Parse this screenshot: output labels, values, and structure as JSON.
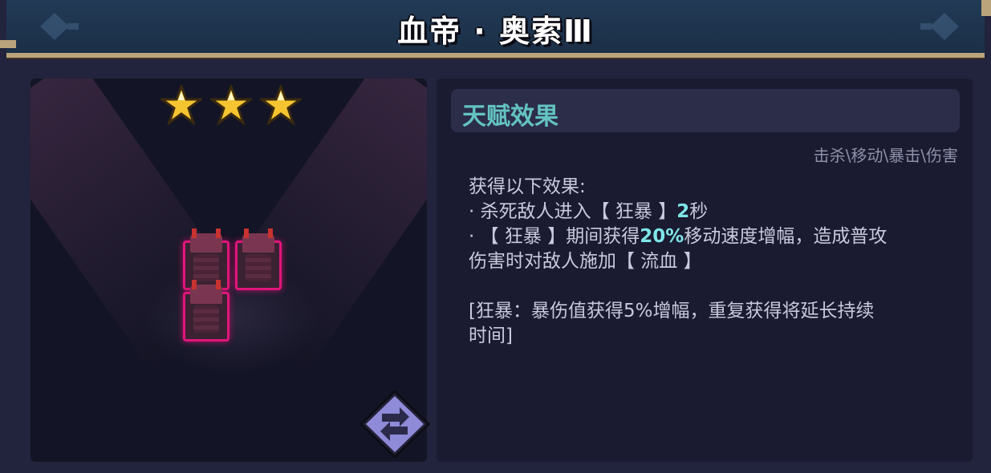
{
  "title": "血帝 · 奥索Ⅲ",
  "stars": {
    "count": 3,
    "max": 3,
    "color": "#f5c531"
  },
  "colors": {
    "accent": "#63c3c1",
    "highlight": "#7fe6e8",
    "unit_border": "#e0157b"
  },
  "icons": {
    "swap": "swap-arrows-icon",
    "star": "star-icon"
  },
  "talent": {
    "header": "天赋效果",
    "tags": "击杀\\移动\\暴击\\伤害",
    "intro": "获得以下效果:",
    "line1_prefix": "· 杀死敌人进入【 狂暴 】",
    "line1_value": "2",
    "line1_suffix": "秒",
    "line2_prefix": "· 【 狂暴 】期间获得",
    "line2_value": "20%",
    "line2_suffix": "移动速度增幅，造成普攻",
    "line3": "伤害时对敌人施加【 流血 】",
    "note_line1": "[狂暴：暴伤值获得5%增幅，重复获得将延长持续",
    "note_line2": "时间]"
  }
}
